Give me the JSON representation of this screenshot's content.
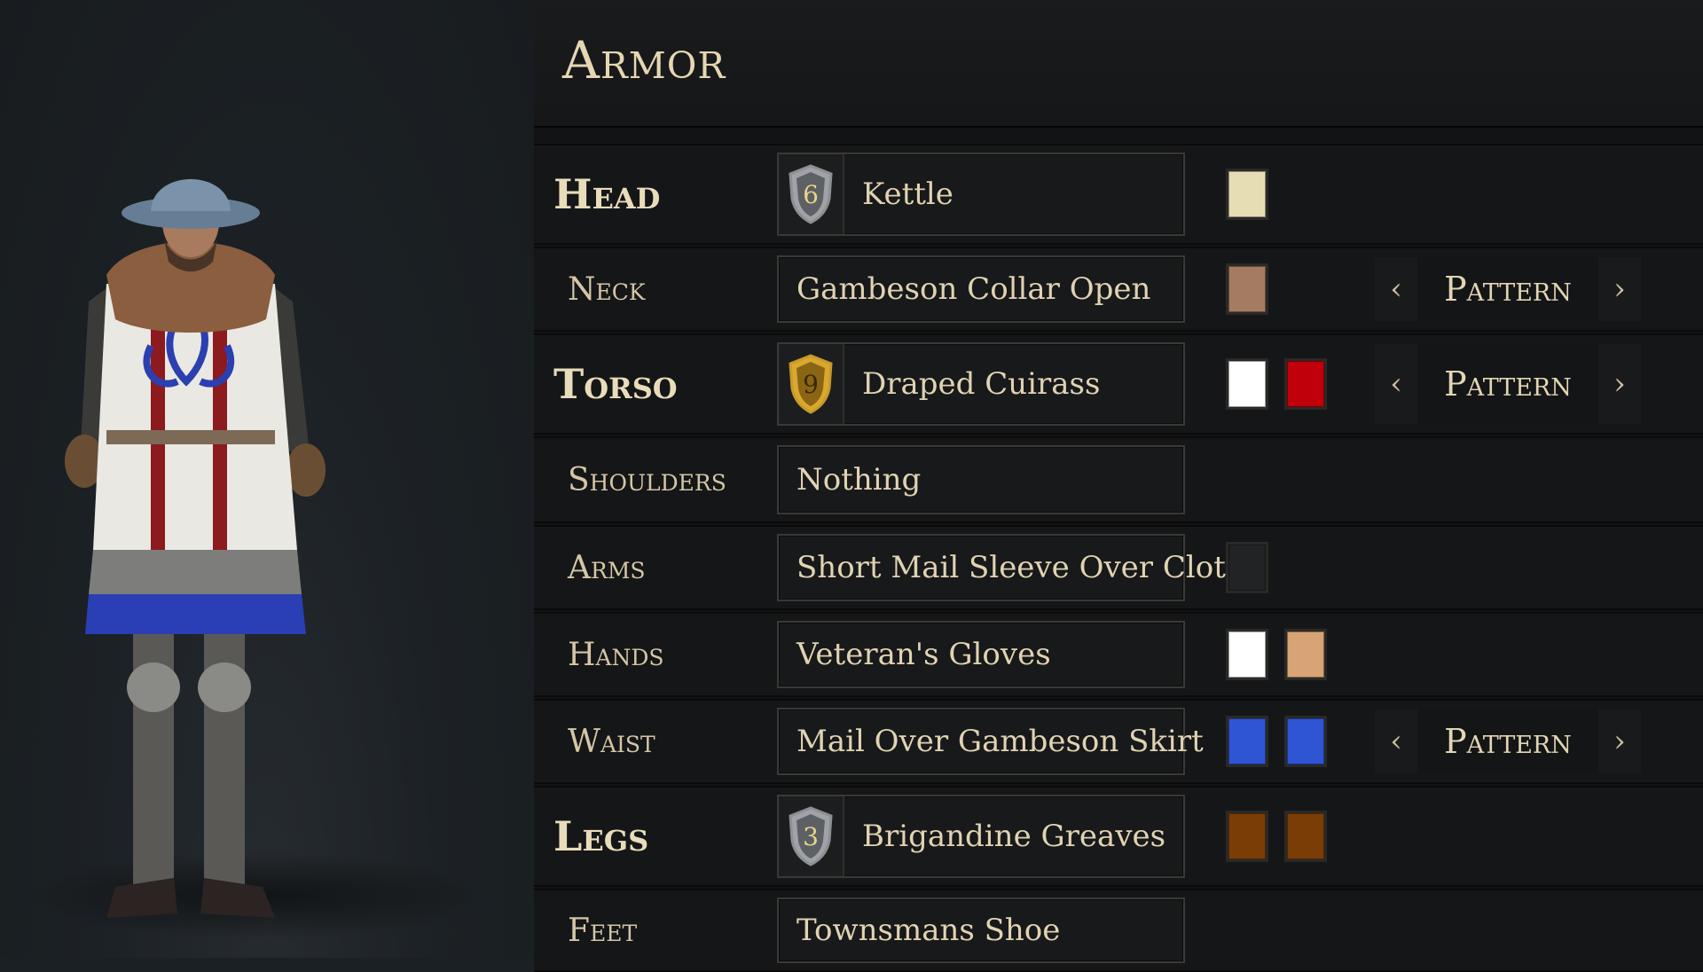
{
  "panel": {
    "title": "Armor"
  },
  "colors": {
    "cream": "#e6ddb5",
    "tan_brown": "#a57b62",
    "white": "#ffffff",
    "red": "#c0000a",
    "dark_gray": "#222324",
    "peach": "#d9a475",
    "blue": "#2f55d4",
    "brown": "#7a3d06"
  },
  "slots": [
    {
      "label": "Head",
      "major": true,
      "item": "Kettle",
      "tier": "6",
      "tier_style": "silver",
      "swatches": [
        "#e6ddb5"
      ],
      "pattern": false
    },
    {
      "label": "Neck",
      "major": false,
      "item": "Gambeson Collar Open",
      "tier": "",
      "swatches": [
        "#a57b62"
      ],
      "pattern": true
    },
    {
      "label": "Torso",
      "major": true,
      "item": "Draped Cuirass",
      "tier": "9",
      "tier_style": "gold",
      "swatches": [
        "#ffffff",
        "#c0000a"
      ],
      "pattern": true
    },
    {
      "label": "Shoulders",
      "major": false,
      "item": "Nothing",
      "tier": "",
      "swatches": [],
      "pattern": false
    },
    {
      "label": "Arms",
      "major": false,
      "item": "Short Mail Sleeve Over Cloth",
      "tier": "",
      "swatches": [
        "#222324"
      ],
      "pattern": false
    },
    {
      "label": "Hands",
      "major": false,
      "item": "Veteran's Gloves",
      "tier": "",
      "swatches": [
        "#ffffff",
        "#d9a475"
      ],
      "pattern": false
    },
    {
      "label": "Waist",
      "major": false,
      "item": "Mail Over Gambeson Skirt",
      "tier": "",
      "swatches": [
        "#2f55d4",
        "#2f55d4"
      ],
      "pattern": true
    },
    {
      "label": "Legs",
      "major": true,
      "item": "Brigandine Greaves",
      "tier": "3",
      "tier_style": "silver",
      "swatches": [
        "#7a3d06",
        "#7a3d06"
      ],
      "pattern": false
    },
    {
      "label": "Feet",
      "major": false,
      "item": "Townsmans Shoe",
      "tier": "",
      "swatches": [],
      "pattern": false
    }
  ],
  "pattern": {
    "label": "Pattern",
    "prev_icon": "chevron-left-icon",
    "next_icon": "chevron-right-icon"
  },
  "preview": {
    "icon": "character-model"
  }
}
